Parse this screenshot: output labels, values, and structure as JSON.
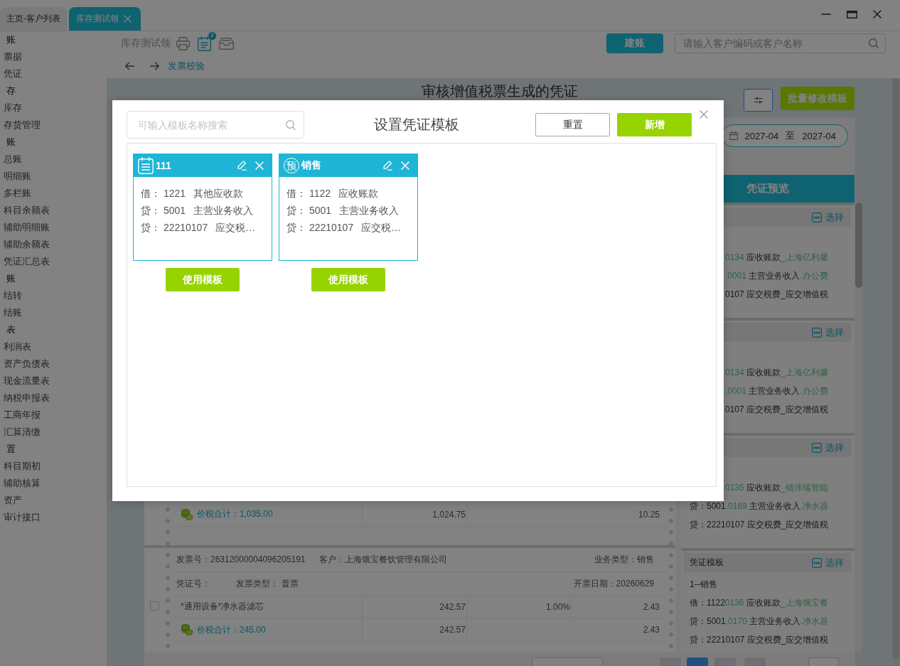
{
  "title_bar": {
    "tabs": [
      {
        "label": "主页-客户列表",
        "selected": false
      },
      {
        "label": "库存测试领",
        "selected": true
      }
    ]
  },
  "sidebar": {
    "groups": [
      {
        "label": "账",
        "children": [
          {
            "label": "票据"
          },
          {
            "label": "凭证"
          }
        ]
      },
      {
        "label": "存",
        "children": [
          {
            "label": "库存"
          },
          {
            "label": "存货管理"
          }
        ]
      },
      {
        "label": "账",
        "children": [
          {
            "label": "总账"
          },
          {
            "label": "明细账"
          },
          {
            "label": "多栏账"
          },
          {
            "label": "科目余额表"
          },
          {
            "label": "辅助明细账"
          },
          {
            "label": "辅助余额表"
          },
          {
            "label": "凭证汇总表"
          }
        ]
      },
      {
        "label": "账",
        "children": [
          {
            "label": "结转"
          },
          {
            "label": "结账"
          }
        ]
      },
      {
        "label": "表",
        "children": [
          {
            "label": "利润表"
          },
          {
            "label": "资产负债表"
          },
          {
            "label": "现金流量表"
          },
          {
            "label": "纳税申报表"
          },
          {
            "label": "工商年报"
          },
          {
            "label": "汇算清缴"
          }
        ]
      },
      {
        "label": "置",
        "children": [
          {
            "label": "科目期初"
          },
          {
            "label": "辅助核算"
          },
          {
            "label": "资产"
          },
          {
            "label": "审计接口"
          }
        ]
      }
    ]
  },
  "toolbar": {
    "title": "库存测试领",
    "badge": "2",
    "create_button": "建账",
    "search": {
      "placeholder": "请输入客户编码或客户名称"
    },
    "breadcrumb": "发票校验"
  },
  "panel": {
    "title": "审核增值税票生成的凭证",
    "batch_button": "批量修改模板",
    "date_range": {
      "from": "2027-04",
      "separator": "至",
      "to": "2027-04"
    },
    "invoices": [
      {
        "total": "价税合计：1,035.00",
        "total_amount": "1,024.75",
        "total_tax": "10.25"
      },
      {
        "checked": false,
        "number": "发票号：26312000004096205191",
        "customer": "客户：上海饿宝餐饮管理有限公司",
        "business_type": "业务类型：销售",
        "voucher_no": "凭证号：",
        "invoice_type_label": "发票类型：",
        "invoice_type": "普票",
        "date": "开票日期：20260629",
        "items": [
          {
            "name": "*通用设备*净水器滤芯",
            "amount": "242.57",
            "rate": "1.00%",
            "tax": "2.43"
          }
        ],
        "total": "价税合计：245.00",
        "total_amount": "242.57",
        "total_tax": "2.43"
      }
    ],
    "preview": {
      "header": "凭证预览",
      "vouchers": [
        {
          "select": "选择",
          "lines": [
            {
              "sub_code": "0134",
              "account": "应收账款",
              "detail": "_上海亿利馨"
            },
            {
              "sub_code": ".0001",
              "account": "主营业务收入",
              "detail": ".办公费"
            },
            {
              "code": "0107",
              "account": "应交税费_应交增值税"
            }
          ]
        },
        {
          "select": "选择",
          "lines": [
            {
              "sub_code": "0134",
              "account": "应收账款",
              "detail": "_上海亿利馨"
            },
            {
              "sub_code": ".0001",
              "account": "主营业务收入",
              "detail": ".办公费"
            },
            {
              "code": "0107",
              "account": "应交税费_应交增值税"
            }
          ]
        },
        {
          "select": "选择",
          "lines": [
            {
              "sub_code": "0135",
              "account": "应收账款",
              "detail": "_错沛瑞智能"
            },
            {
              "direction": "贷：",
              "code": "5001",
              "sub_code": ".0169",
              "account": "主营业务收入",
              "detail": ".净水器"
            },
            {
              "direction": "贷：",
              "code": "22210107",
              "account": "应交税费_应交增值税"
            }
          ]
        },
        {
          "title": "凭证模板",
          "select": "选择",
          "template": "1--销售",
          "lines": [
            {
              "direction": "借：",
              "code": "1122",
              "sub_code": "0136",
              "account": "应收账款",
              "detail": "_上海饿宝餐"
            },
            {
              "direction": "贷：",
              "code": "5001",
              "sub_code": ".0170",
              "account": "主营业务收入",
              "detail": ".净水器"
            },
            {
              "direction": "贷：",
              "code": "22210107",
              "account": "应交税费_应交增值税"
            }
          ]
        }
      ]
    },
    "pagination": {
      "pages": [
        {
          "selected": true
        },
        {
          "selected": false
        }
      ]
    }
  },
  "modal": {
    "title": "设置凭证模板",
    "search": {
      "placeholder": "可输入模板名称搜索"
    },
    "buttons": [
      {
        "label": "重置",
        "kind": "secondary"
      },
      {
        "label": "新增",
        "kind": "primary"
      }
    ],
    "templates": [
      {
        "kind": "list",
        "name": "111",
        "lines": [
          {
            "direction": "借：",
            "code": "1221",
            "account": "其他应收款"
          },
          {
            "direction": "贷：",
            "code": "5001",
            "account": "主营业务收入"
          },
          {
            "direction": "贷：",
            "code": "22210107",
            "account": "应交税…"
          }
        ],
        "use_button": "使用模板"
      },
      {
        "kind": "badge",
        "badge": "预",
        "name": "销售",
        "lines": [
          {
            "direction": "借：",
            "code": "1122",
            "account": "应收账款"
          },
          {
            "direction": "贷：",
            "code": "5001",
            "account": "主营业务收入"
          },
          {
            "direction": "贷：",
            "code": "22210107",
            "account": "应交税…"
          }
        ],
        "use_button": "使用模板"
      }
    ]
  }
}
